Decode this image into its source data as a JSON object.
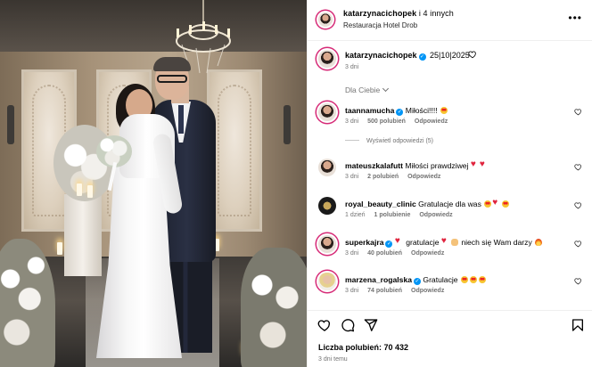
{
  "post": {
    "author": "katarzynacichopek",
    "coauthors": "i 4 innych",
    "location": "Restauracja Hotel Drob",
    "caption": "25|10|2025",
    "caption_time": "3 dni",
    "sort_label": "Dla Ciebie",
    "more_menu": "•••"
  },
  "comments": [
    {
      "user": "taannamucha",
      "verified": true,
      "text": "Miłości!!!!",
      "emoji": [
        "face"
      ],
      "time": "3 dni",
      "likes": "500 polubień",
      "reply": "Odpowiedz"
    },
    {
      "user": "mateuszkalafutt",
      "verified": false,
      "text": "Miłości prawdziwej",
      "emoji": [
        "heart",
        "heart"
      ],
      "time": "3 dni",
      "likes": "2 polubień",
      "reply": "Odpowiedz"
    },
    {
      "user": "royal_beauty_clinic",
      "verified": false,
      "text": "Gratulacje dla was",
      "emoji": [
        "face",
        "heart",
        "face"
      ],
      "time": "1 dzień",
      "likes": "1 polubienie",
      "reply": "Odpowiedz"
    },
    {
      "user": "superkajra",
      "verified": true,
      "text_a": "gratulacje",
      "text_b": "niech się Wam darzy",
      "time": "3 dni",
      "likes": "40 polubień",
      "reply": "Odpowiedz"
    },
    {
      "user": "marzena_rogalska",
      "verified": true,
      "text": "Gratulacje",
      "emoji": [
        "face",
        "face",
        "face"
      ],
      "time": "3 dni",
      "likes": "74 polubień",
      "reply": "Odpowiedz"
    }
  ],
  "view_replies": "Wyświetl odpowiedzi (5)",
  "footer": {
    "likes": "Liczba polubień: 70 432",
    "ago": "3 dni temu"
  },
  "icons": [
    "heart-icon",
    "comment-icon",
    "share-icon",
    "bookmark-icon",
    "more-icon",
    "verified-icon"
  ],
  "colors": {
    "verified": "#0095f6",
    "secondary_text": "#737373",
    "heart_red": "#e0233d"
  }
}
